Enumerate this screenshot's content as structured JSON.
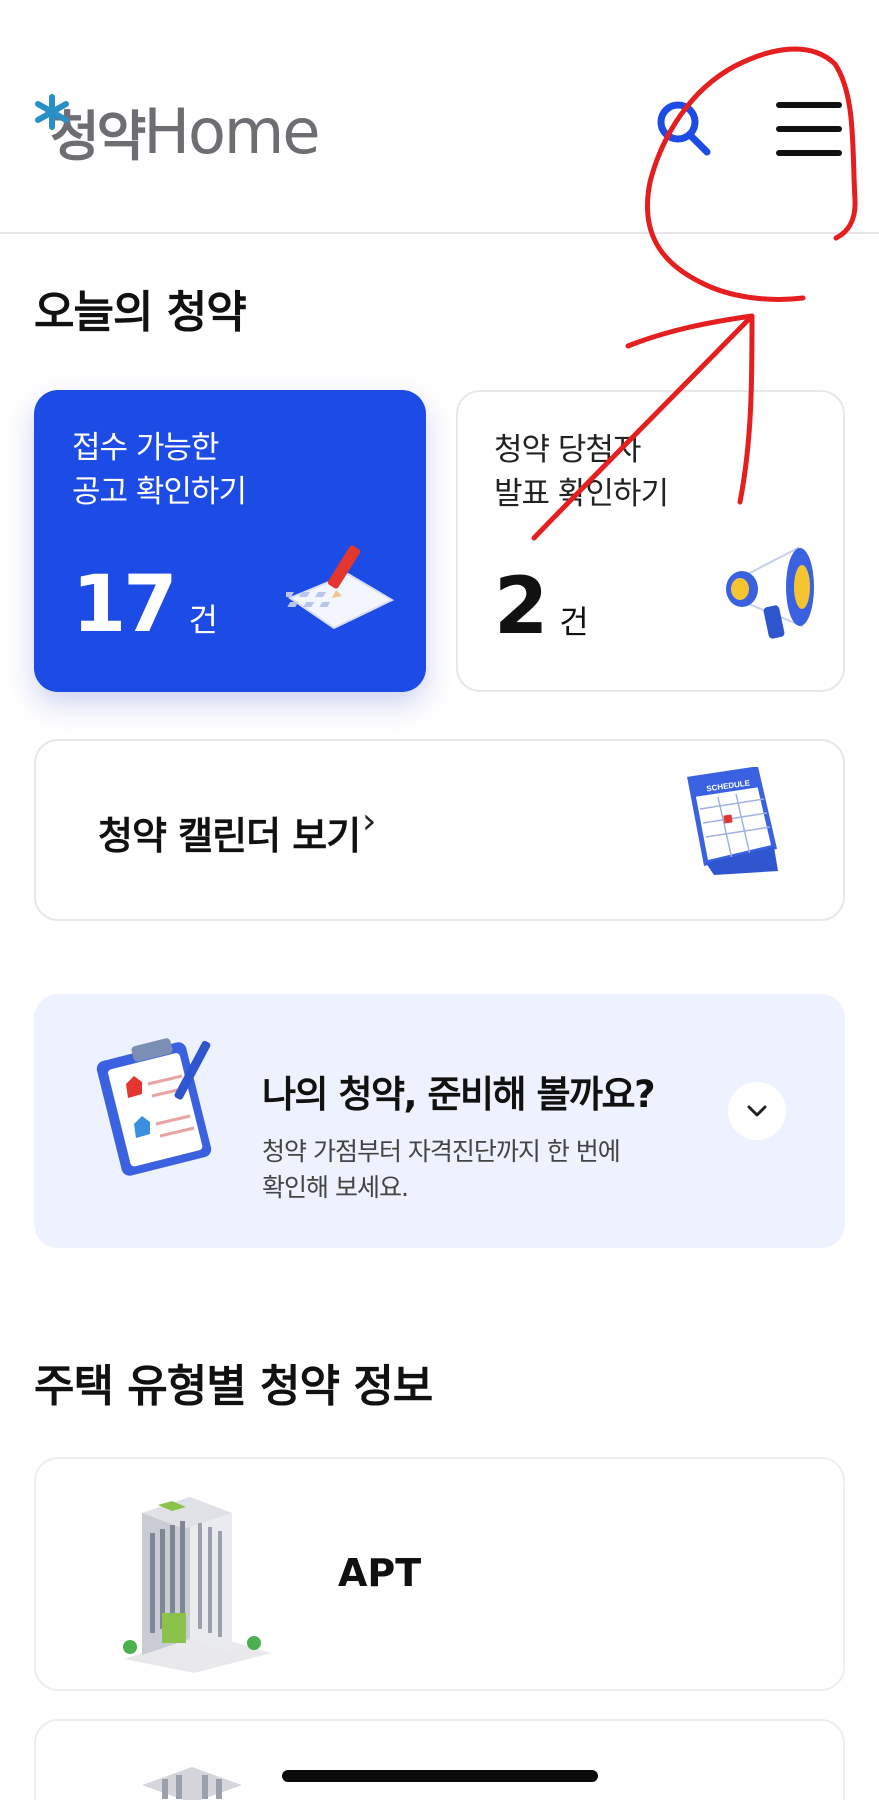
{
  "header": {
    "logo_ko": "청약",
    "logo_en": "Home",
    "search_icon": "search-icon",
    "menu_icon": "hamburger-menu-icon"
  },
  "today": {
    "title": "오늘의 청약",
    "open_card": {
      "label": "접수 가능한\n공고 확인하기",
      "count": "17",
      "unit": "건",
      "icon": "application-form-icon"
    },
    "winner_card": {
      "label": "청약 당첨자\n발표 확인하기",
      "count": "2",
      "unit": "건",
      "icon": "megaphone-icon"
    },
    "calendar": {
      "label": "청약 캘린더 보기",
      "chevron": "›",
      "icon": "calendar-icon",
      "calendar_word": "SCHEDULE"
    }
  },
  "prepare": {
    "title": "나의 청약, 준비해 볼까요?",
    "description": "청약 가점부터 자격진단까지 한 번에 확인해 보세요.",
    "icon": "clipboard-icon",
    "toggle_icon": "chevron-down-icon"
  },
  "housing": {
    "title": "주택 유형별 청약 정보",
    "items": [
      {
        "label": "APT",
        "icon": "apartment-building-icon"
      },
      {
        "label": "",
        "icon": "building-icon"
      }
    ]
  },
  "colors": {
    "brand_blue": "#1d4be6",
    "logo_star": "#2a8fc7",
    "annotation_red": "#e51f1f",
    "prepare_bg": "#eef1fe"
  }
}
